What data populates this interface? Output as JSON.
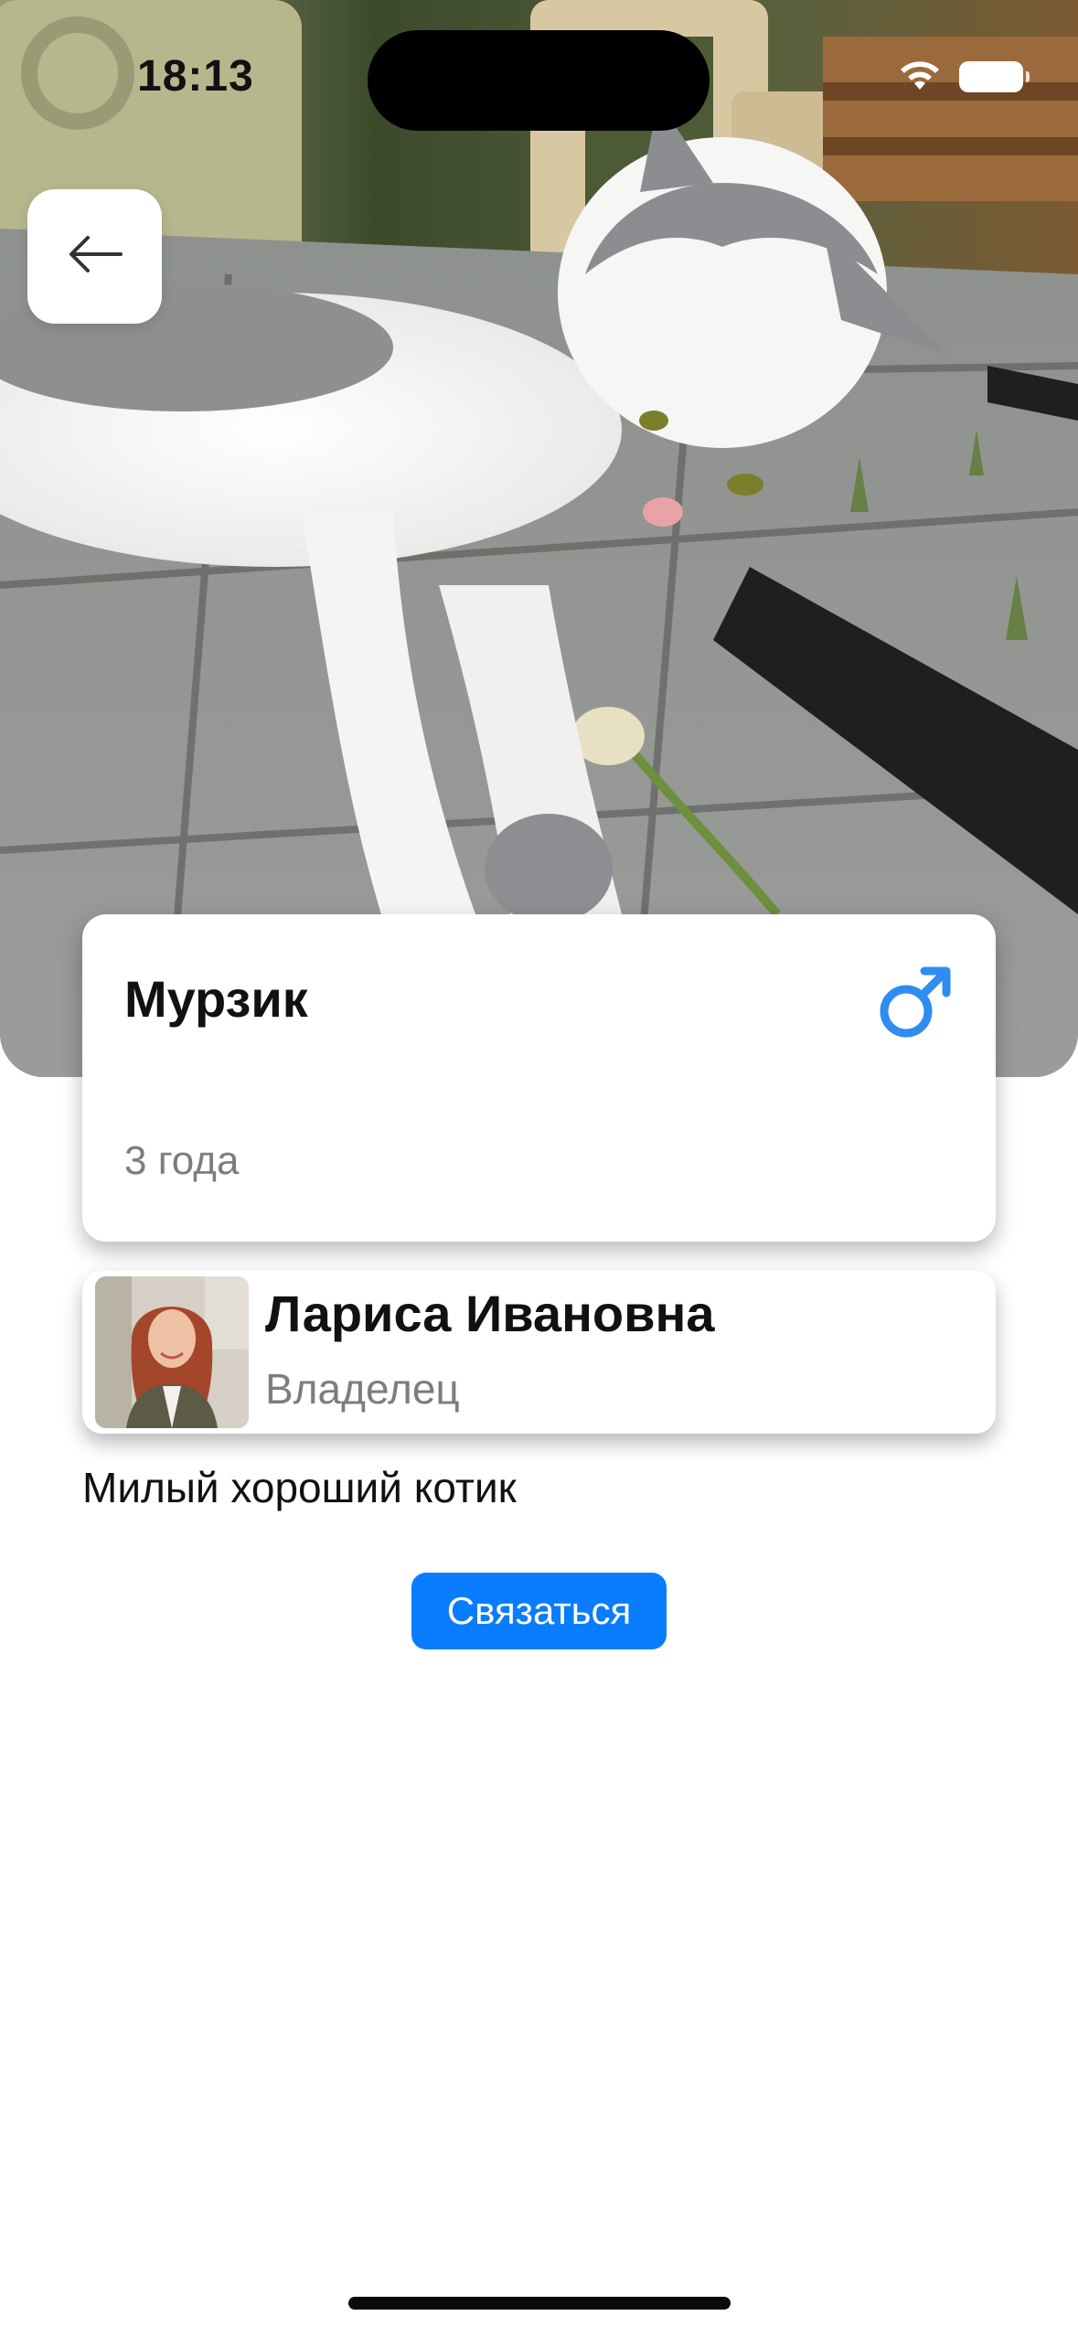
{
  "status_bar": {
    "time": "18:13",
    "icons": [
      "wifi-icon",
      "battery-icon"
    ]
  },
  "hero": {
    "image": "cat-photo"
  },
  "back_button": {
    "icon": "arrow-left-icon"
  },
  "pet": {
    "name": "Мурзик",
    "gender_icon": "male-symbol-icon",
    "gender_color": "#2f8cf0",
    "age": "3 года"
  },
  "owner": {
    "name": "Лариса Ивановна",
    "role": "Владелец",
    "avatar": "owner-avatar"
  },
  "description": "Милый хороший котик",
  "contact_button": {
    "label": "Связаться",
    "color": "#0a7cff"
  }
}
